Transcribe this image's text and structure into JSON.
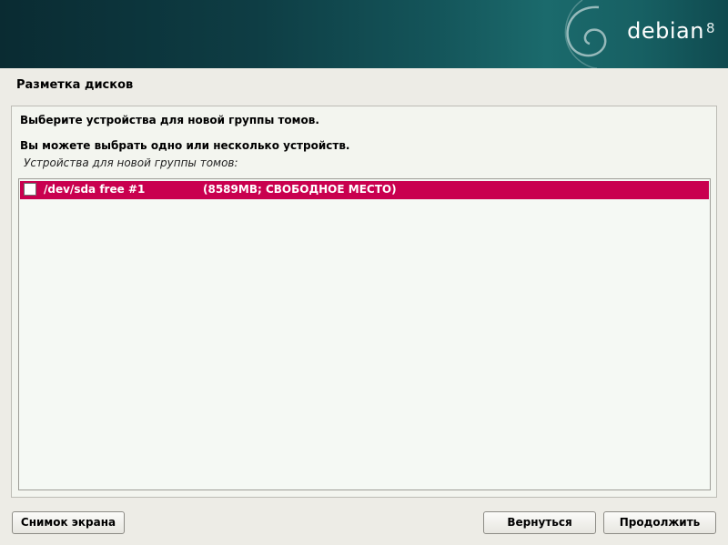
{
  "brand": {
    "name": "debian",
    "version": "8"
  },
  "page": {
    "title": "Разметка дисков"
  },
  "dialog": {
    "question": "Выберите устройства для новой группы томов.",
    "hint": "Вы можете выбрать одно или несколько устройств.",
    "list_label": "Устройства для новой группы томов:",
    "items": [
      {
        "device": "/dev/sda free #1",
        "size": "(8589MB; СВОБОДНОЕ МЕСТО)",
        "checked": false,
        "selected": true
      }
    ]
  },
  "buttons": {
    "screenshot": "Снимок экрана",
    "back": "Вернуться",
    "continue": "Продолжить"
  },
  "colors": {
    "selection": "#c9004f",
    "background": "#edece6",
    "banner": "#0e3d44"
  },
  "icons": {
    "logo": "debian-swirl-icon"
  }
}
